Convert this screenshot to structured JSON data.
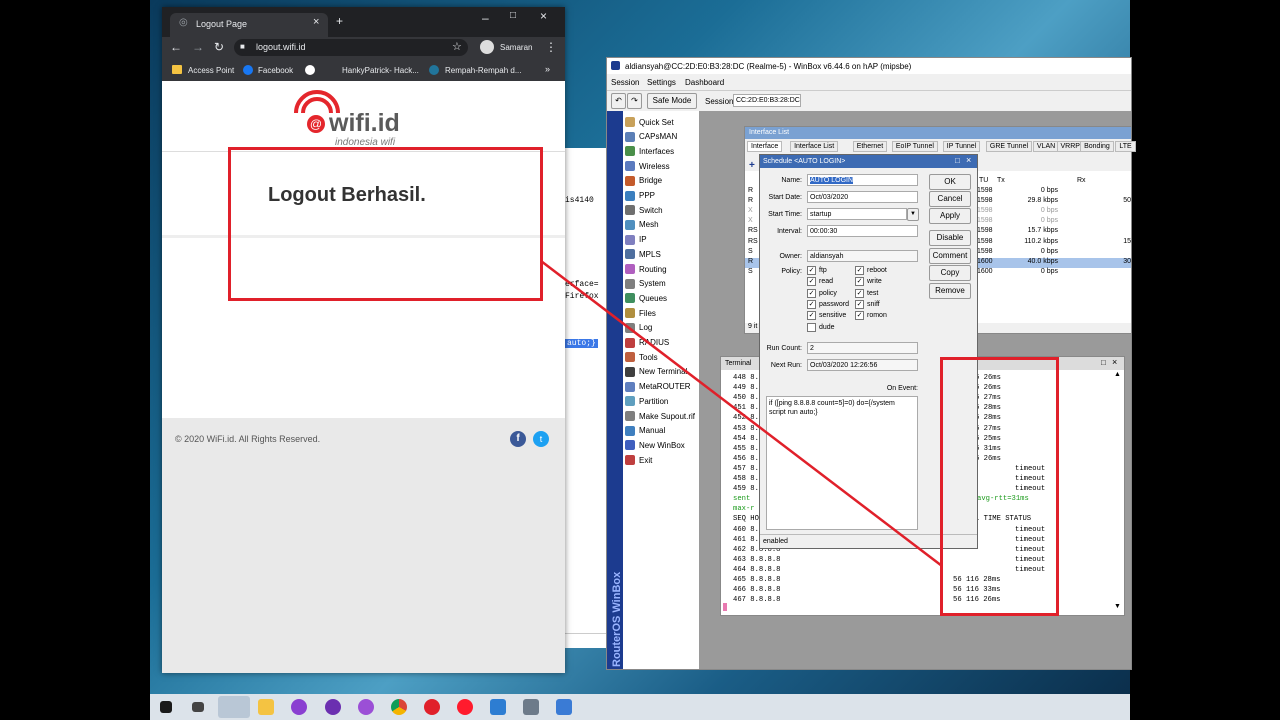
{
  "chrome": {
    "tab_title": "Logout Page",
    "url": "logout.wifi.id",
    "profile": "Samaran",
    "bookmarks": [
      "Access Point",
      "Facebook",
      "HankyPatrick- Hack...",
      "Rempah-Rempah d..."
    ],
    "logo_text": "wifi.id",
    "logo_sub": "indonesia wifi",
    "heading": "Logout Berhasil.",
    "footer": "© 2020 WiFi.id. All Rights Reserved."
  },
  "bg_fragments": [
    "is4140",
    "erface=",
    "Firefox",
    "auto;}"
  ],
  "winbox": {
    "title": "aldiansyah@CC:2D:E0:B3:28:DC (Realme-5) - WinBox v6.44.6 on hAP (mipsbe)",
    "menu": [
      "Session",
      "Settings",
      "Dashboard"
    ],
    "safe_mode": "Safe Mode",
    "session_label": "Session:",
    "session_value": "CC:2D:E0:B3:28:DC",
    "vertical_label": "RouterOS WinBox",
    "sidebar": [
      "Quick Set",
      "CAPsMAN",
      "Interfaces",
      "Wireless",
      "Bridge",
      "PPP",
      "Switch",
      "Mesh",
      "IP",
      "MPLS",
      "Routing",
      "System",
      "Queues",
      "Files",
      "Log",
      "RADIUS",
      "Tools",
      "New Terminal",
      "MetaROUTER",
      "Partition",
      "Make Supout.rif",
      "Manual",
      "New WinBox",
      "Exit"
    ]
  },
  "iflist": {
    "title": "Interface List",
    "tabs": [
      "Interface",
      "Interface List",
      "Ethernet",
      "EoIP Tunnel",
      "IP Tunnel",
      "GRE Tunnel",
      "VLAN",
      "VRRP",
      "Bonding",
      "LTE"
    ],
    "col_tu": "TU",
    "col_tx": "Tx",
    "col_rx": "Rx",
    "flags": [
      "R",
      "R",
      "X",
      "X",
      "RS",
      "RS",
      "S",
      "R",
      "S"
    ],
    "mtu": [
      "1598",
      "1598",
      "1598",
      "1598",
      "1598",
      "1598",
      "1598",
      "1600",
      "1600"
    ],
    "tx": [
      "0 bps",
      "29.8 kbps",
      "0 bps",
      "0 bps",
      "15.7 kbps",
      "110.2 kbps",
      "0 bps",
      "40.0 kbps",
      "0 bps"
    ],
    "rx": [
      "",
      "50",
      "",
      "",
      "",
      "15",
      "",
      "30",
      ""
    ],
    "count": "9 it"
  },
  "terminal": {
    "title": "Terminal",
    "lines": [
      "448 8.",
      "449 8.",
      "450 8.",
      "451 8.",
      "452 8.",
      "453 8.",
      "454 8.",
      "455 8.",
      "456 8.",
      "457 8.",
      "458 8.",
      "459 8.",
      "  sent",
      " max-r",
      "SEQ HO",
      "460 8.",
      "461 8.",
      "462 8.8.8.8",
      "463 8.8.8.8",
      "464 8.8.8.8",
      "465 8.8.8.8",
      "466 8.8.8.8",
      "467 8.8.8.8"
    ],
    "right_lines": [
      "6 26ms",
      "6 26ms",
      "6 27ms",
      "6 28ms",
      "6 28ms",
      "6 27ms",
      "6 25ms",
      "6 31ms",
      "6 26ms",
      "timeout",
      "timeout",
      "timeout",
      "avg-rtt=31ms",
      "",
      "L TIME  STATUS",
      "timeout",
      "timeout",
      "timeout",
      "timeout",
      "timeout",
      "56 116 28ms",
      "56 116 33ms",
      "56 116 26ms"
    ]
  },
  "schedule": {
    "title": "Schedule <AUTO LOGIN>",
    "name_label": "Name:",
    "name": "AUTO LOGIN",
    "start_date_label": "Start Date:",
    "start_date": "Oct/03/2020",
    "start_time_label": "Start Time:",
    "start_time": "startup",
    "interval_label": "Interval:",
    "interval": "00:00:30",
    "owner_label": "Owner:",
    "owner": "aldiansyah",
    "policy_label": "Policy:",
    "policies_left": [
      "ftp",
      "read",
      "policy",
      "password",
      "sensitive",
      "dude"
    ],
    "policies_left_checked": [
      true,
      true,
      true,
      true,
      true,
      false
    ],
    "policies_right": [
      "reboot",
      "write",
      "test",
      "sniff",
      "romon"
    ],
    "run_count_label": "Run Count:",
    "run_count": "2",
    "next_run_label": "Next Run:",
    "next_run": "Oct/03/2020 12:26:56",
    "on_event_label": "On Event:",
    "on_event": "if ([ping 8.8.8.8 count=5]=0) do={/system script run auto;}",
    "status": "enabled",
    "buttons": [
      "OK",
      "Cancel",
      "Apply",
      "Disable",
      "Comment",
      "Copy",
      "Remove"
    ]
  },
  "colors": {
    "highlight": "#e0202a",
    "wifi_red": "#e4262c",
    "winbox_blue": "#1c3b8f"
  }
}
